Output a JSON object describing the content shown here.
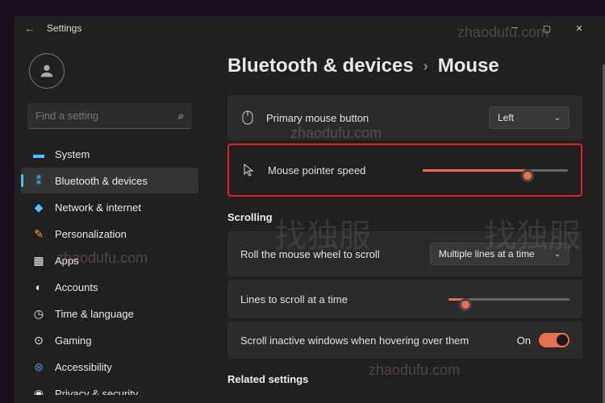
{
  "titlebar": {
    "title": "Settings"
  },
  "search": {
    "placeholder": "Find a setting"
  },
  "nav": {
    "items": [
      {
        "label": "System"
      },
      {
        "label": "Bluetooth & devices"
      },
      {
        "label": "Network & internet"
      },
      {
        "label": "Personalization"
      },
      {
        "label": "Apps"
      },
      {
        "label": "Accounts"
      },
      {
        "label": "Time & language"
      },
      {
        "label": "Gaming"
      },
      {
        "label": "Accessibility"
      },
      {
        "label": "Privacy & security"
      }
    ]
  },
  "breadcrumb": {
    "parent": "Bluetooth & devices",
    "current": "Mouse"
  },
  "rows": {
    "primary": {
      "label": "Primary mouse button",
      "value": "Left"
    },
    "speed": {
      "label": "Mouse pointer speed",
      "slider": 72
    },
    "scroll_section": "Scrolling",
    "wheel": {
      "label": "Roll the mouse wheel to scroll",
      "value": "Multiple lines at a time"
    },
    "lines": {
      "label": "Lines to scroll at a time",
      "slider": 14
    },
    "inactive": {
      "label": "Scroll inactive windows when hovering over them",
      "value": "On"
    },
    "related": "Related settings"
  }
}
